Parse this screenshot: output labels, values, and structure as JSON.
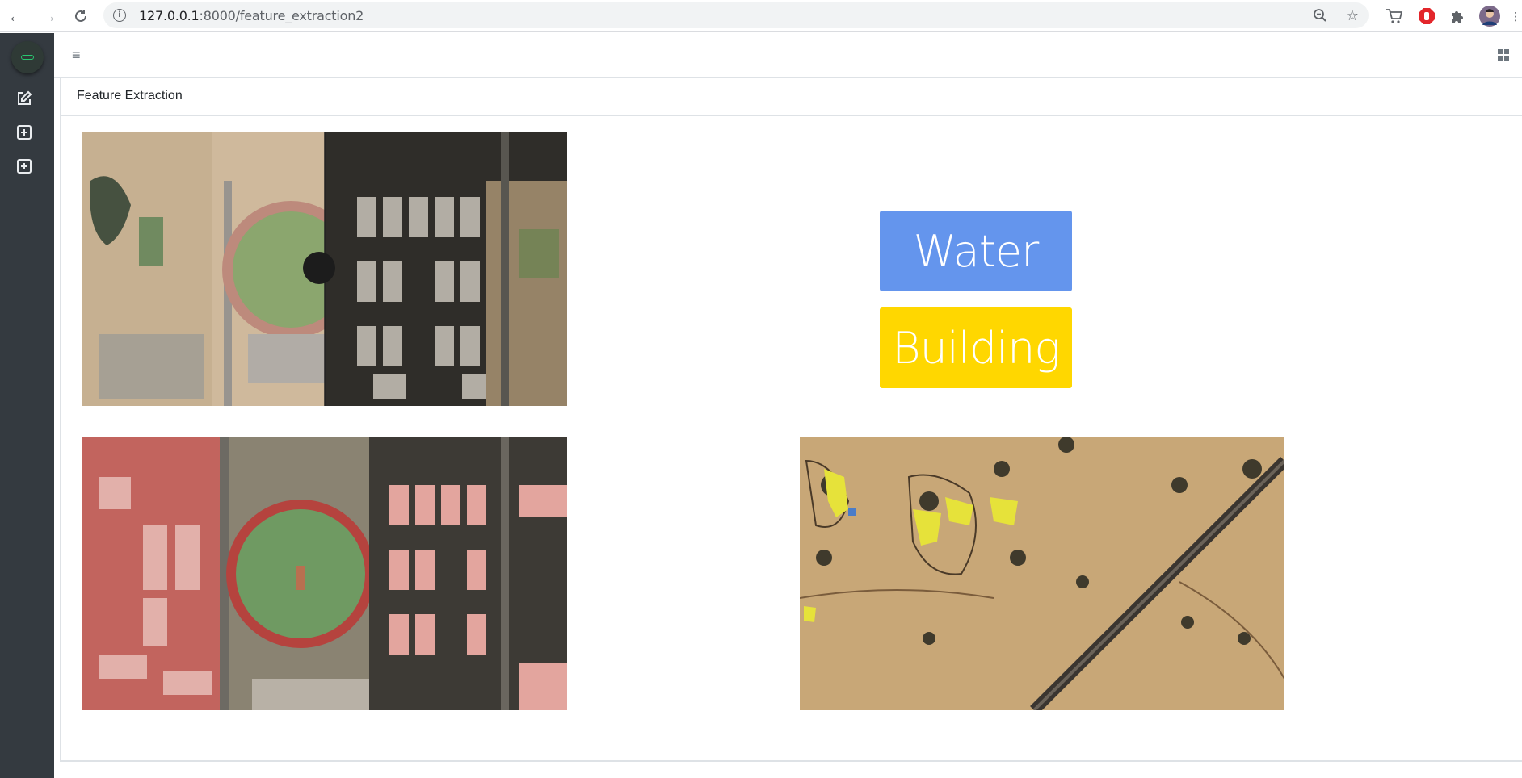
{
  "browser": {
    "url_host": "127.0.0.1",
    "url_path": ":8000/feature_extraction2"
  },
  "page": {
    "title": "Feature Extraction"
  },
  "buttons": {
    "water_label": "Water",
    "building_label": "Building"
  },
  "colors": {
    "water": "#6495ed",
    "building": "#ffd700",
    "sidebar": "#343a40",
    "accent": "#28c76f"
  },
  "sidebar": {
    "items": [
      {
        "icon": "edit-icon"
      },
      {
        "icon": "plus-square-icon"
      },
      {
        "icon": "plus-square-icon"
      }
    ]
  }
}
